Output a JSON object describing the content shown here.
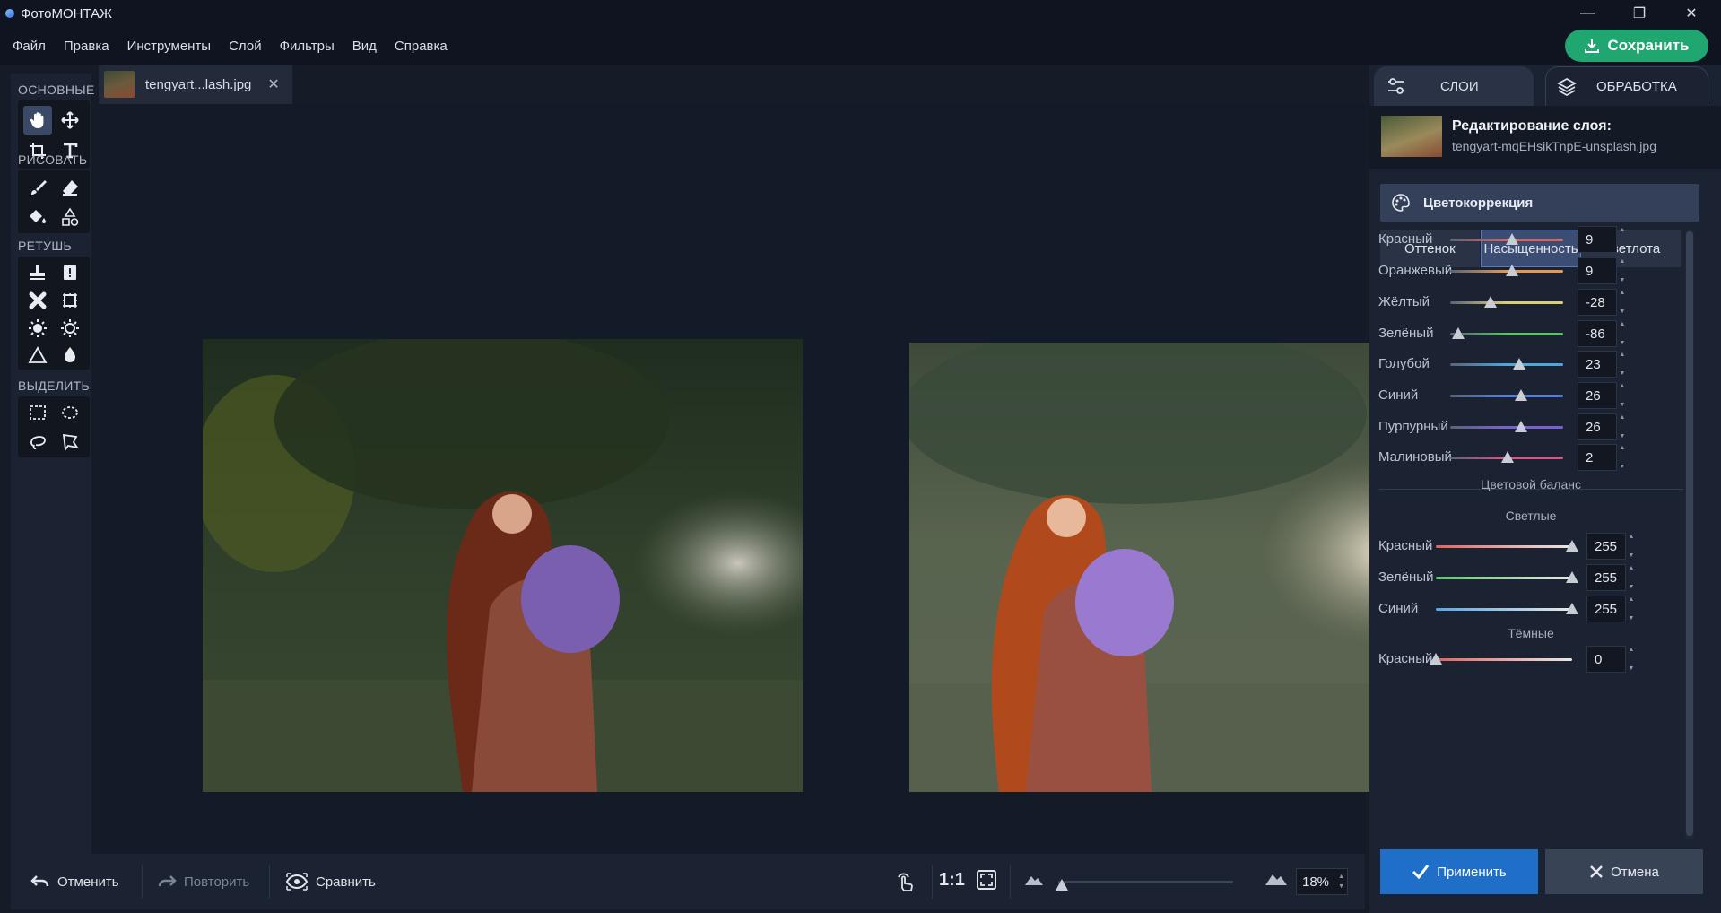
{
  "app": {
    "title": "ФотоМОНТАЖ"
  },
  "window_controls": {
    "minimize": "—",
    "restore": "❐",
    "close": "✕"
  },
  "menu": [
    "Файл",
    "Правка",
    "Инструменты",
    "Слой",
    "Фильтры",
    "Вид",
    "Справка"
  ],
  "save_button": {
    "label": "Сохранить"
  },
  "toolbar": {
    "groups": [
      "ОСНОВНЫЕ",
      "РИСОВАТЬ",
      "РЕТУШЬ",
      "ВЫДЕЛИТЬ"
    ]
  },
  "document_tab": {
    "name": "tengyart...lash.jpg",
    "close": "✕"
  },
  "bottom_bar": {
    "undo": "Отменить",
    "redo": "Повторить",
    "compare": "Сравнить",
    "ratio": "1:1",
    "zoom_value": "18%",
    "zoom_level": 0.18
  },
  "right_panel": {
    "tabs": [
      {
        "label": "СЛОИ"
      },
      {
        "label": "ОБРАБОТКА"
      }
    ],
    "layer_heading": "Редактирование слоя:",
    "layer_file": "tengyart-mqEHsikTnpE-unsplash.jpg",
    "section": "Цветокоррекция",
    "subtabs": [
      "Оттенок",
      "Насыщенность",
      "Светлота"
    ],
    "saturation": [
      {
        "label": "Красный",
        "value": "9",
        "color": "#e0605e"
      },
      {
        "label": "Оранжевый",
        "value": "9",
        "color": "#e09a55"
      },
      {
        "label": "Жёлтый",
        "value": "-28",
        "color": "#d8cf7a"
      },
      {
        "label": "Зелёный",
        "value": "-86",
        "color": "#5fbf6a"
      },
      {
        "label": "Голубой",
        "value": "23",
        "color": "#4fa6d8"
      },
      {
        "label": "Синий",
        "value": "26",
        "color": "#4f7ee0"
      },
      {
        "label": "Пурпурный",
        "value": "26",
        "color": "#7f5fd0"
      },
      {
        "label": "Малиновый",
        "value": "2",
        "color": "#d05a8a"
      }
    ],
    "balance_title": "Цветовой баланс",
    "lights_title": "Светлые",
    "lights": [
      {
        "label": "Красный",
        "value": "255",
        "color": "#e2645f"
      },
      {
        "label": "Зелёный",
        "value": "255",
        "color": "#63c46b"
      },
      {
        "label": "Синий",
        "value": "255",
        "color": "#5aa6e4"
      }
    ],
    "darks_title": "Тёмные",
    "darks": [
      {
        "label": "Красный",
        "value": "0",
        "color": "#e2645f"
      }
    ],
    "apply": "Применить",
    "cancel": "Отмена"
  }
}
